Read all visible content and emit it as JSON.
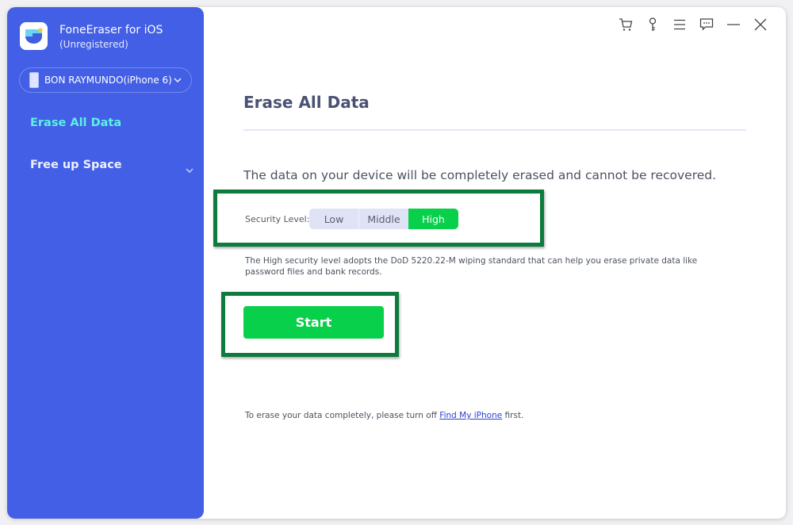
{
  "app": {
    "title": "FoneEraser for iOS",
    "subtitle": "(Unregistered)"
  },
  "device": {
    "name": "BON RAYMUNDO(iPhone 6)"
  },
  "sidebar": {
    "items": [
      {
        "label": "Erase All Data",
        "active": true
      },
      {
        "label": "Free up Space",
        "active": false,
        "expandable": true
      }
    ]
  },
  "toolbar": {
    "icons": [
      "cart-icon",
      "key-icon",
      "menu-icon",
      "chat-icon",
      "minimize-icon",
      "close-icon"
    ]
  },
  "main": {
    "title": "Erase All Data",
    "warning": "The data on your device will be completely erased and cannot be recovered.",
    "security": {
      "label": "Security Level:",
      "options": [
        "Low",
        "Middle",
        "High"
      ],
      "selected": "High"
    },
    "description": "The High security level adopts the DoD 5220.22-M wiping standard that can help you erase private data like password files and bank records.",
    "start_label": "Start",
    "footer": {
      "prefix": "To erase your data completely, please turn off ",
      "link": "Find My iPhone",
      "suffix": " first."
    }
  },
  "colors": {
    "sidebar": "#425fe6",
    "active_nav": "#5cf1e3",
    "accent_green": "#08d04a",
    "highlight_border": "#0d7a3e"
  }
}
